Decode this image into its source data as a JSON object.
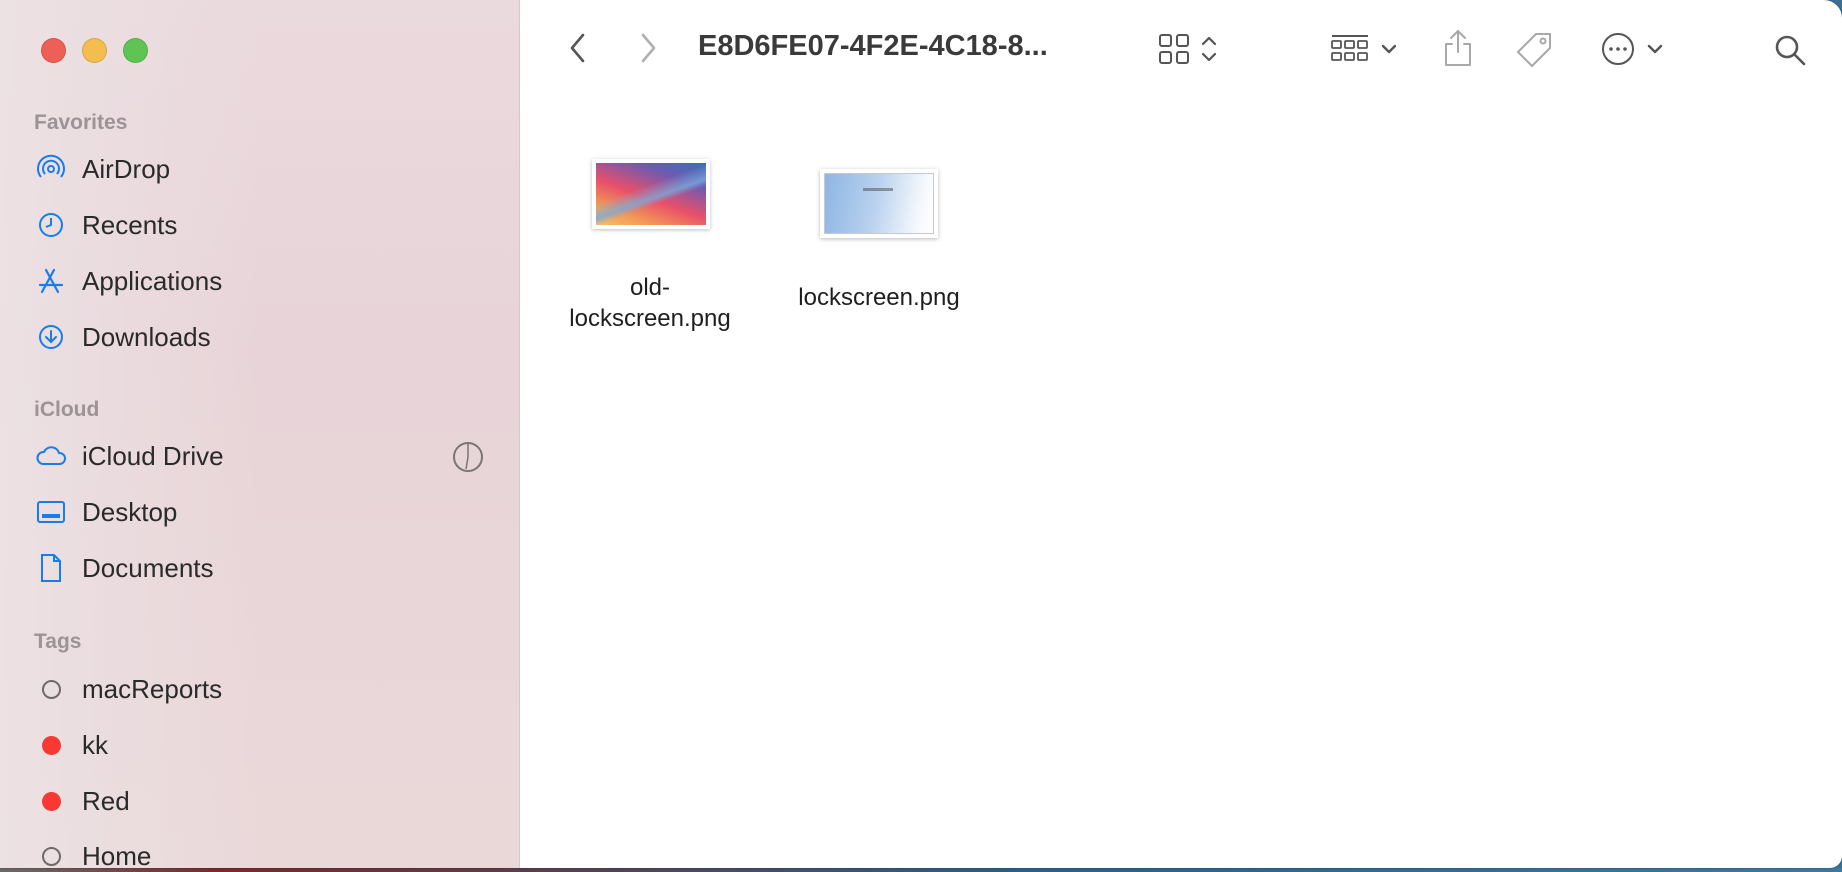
{
  "window": {
    "title": "E8D6FE07-4F2E-4C18-8..."
  },
  "sidebar": {
    "sections": [
      {
        "heading": "Favorites",
        "items": [
          {
            "label": "AirDrop",
            "icon": "airdrop-icon"
          },
          {
            "label": "Recents",
            "icon": "clock-icon"
          },
          {
            "label": "Applications",
            "icon": "applications-icon"
          },
          {
            "label": "Downloads",
            "icon": "download-icon"
          }
        ]
      },
      {
        "heading": "iCloud",
        "items": [
          {
            "label": "iCloud Drive",
            "icon": "cloud-icon"
          },
          {
            "label": "Desktop",
            "icon": "desktop-icon"
          },
          {
            "label": "Documents",
            "icon": "document-icon"
          }
        ]
      },
      {
        "heading": "Tags",
        "items": [
          {
            "label": "macReports",
            "tag_color": "none"
          },
          {
            "label": "kk",
            "tag_color": "#f63a33"
          },
          {
            "label": "Red",
            "tag_color": "#f63a33"
          },
          {
            "label": "Home",
            "tag_color": "none"
          }
        ]
      }
    ]
  },
  "files": [
    {
      "name_line1": "old-",
      "name_line2": "lockscreen.png"
    },
    {
      "name_line1": "lockscreen.png",
      "name_line2": ""
    }
  ],
  "colors": {
    "accent": "#1a7ce8",
    "tag_red": "#f63a33",
    "close": "#ee5f57",
    "minimize": "#f4bd4f",
    "zoom": "#5fc454"
  }
}
